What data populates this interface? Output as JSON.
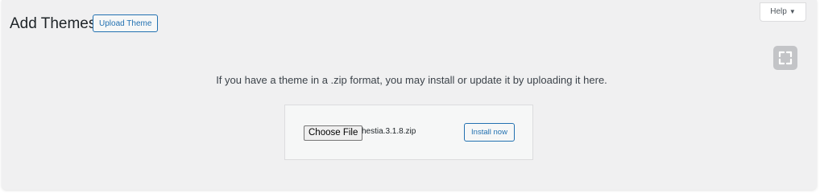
{
  "header": {
    "title": "Add Themes",
    "upload_button": "Upload Theme",
    "help_label": "Help",
    "help_caret": "▼"
  },
  "toolbar": {
    "fullscreen_icon": "fullscreen-icon"
  },
  "upload": {
    "instructions": "If you have a theme in a .zip format, you may install or update it by uploading it here.",
    "choose_file_label": "Choose File",
    "file_name": "hestia.3.1.8.zip",
    "install_button": "Install now"
  },
  "colors": {
    "accent": "#2271b1",
    "background": "#f0f0f1",
    "text": "#1d2327"
  }
}
